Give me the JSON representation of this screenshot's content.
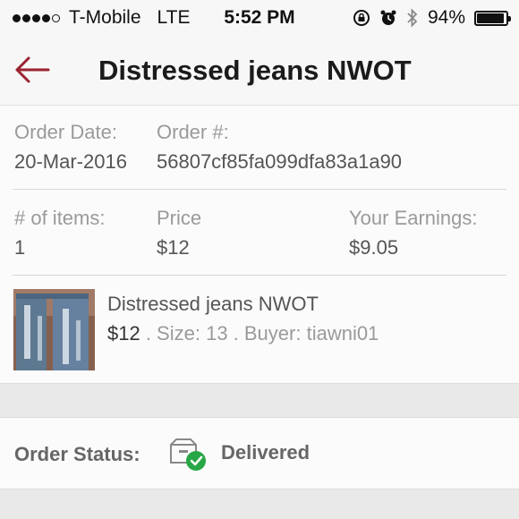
{
  "status_bar": {
    "carrier": "T-Mobile",
    "network": "LTE",
    "time": "5:52 PM",
    "battery": "94%",
    "battery_level": 0.94
  },
  "nav": {
    "title": "Distressed jeans NWOT",
    "back_icon": "back-arrow-icon",
    "accent_color": "#9b2230"
  },
  "order": {
    "date_label": "Order Date:",
    "date_value": "20-Mar-2016",
    "number_label": "Order #:",
    "number_value": "56807cf85fa099dfa83a1a90",
    "items_label": "# of items:",
    "items_value": "1",
    "price_label": "Price",
    "price_value": "$12",
    "earnings_label": "Your Earnings:",
    "earnings_value": "$9.05"
  },
  "item": {
    "title": "Distressed jeans NWOT",
    "price": "$12",
    "details": " . Size: 13 . Buyer: tiawni01"
  },
  "order_status": {
    "label": "Order Status:",
    "value": "Delivered",
    "icon": "delivered-box-check-icon",
    "check_color": "#27a745"
  }
}
